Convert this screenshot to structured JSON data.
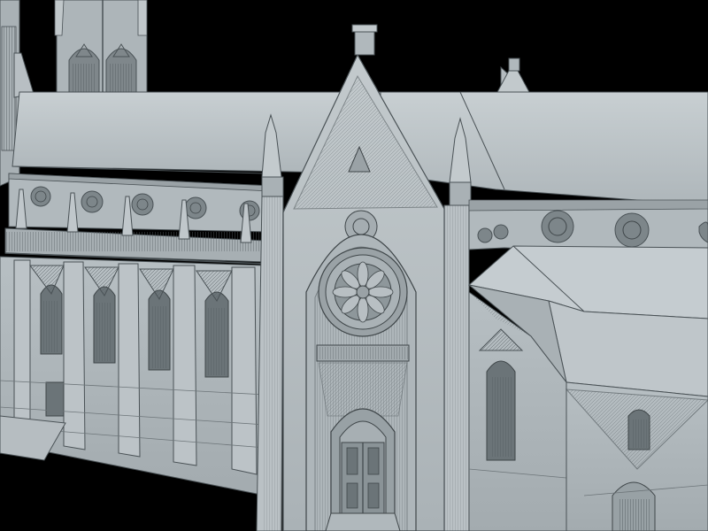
{
  "scene": {
    "subject": "gothic-cathedral-3d-model",
    "render_style": "wireframe-over-shaded",
    "colors": {
      "background": "#000000",
      "surface": "#b4bcc0",
      "surface_light": "#c4cbce",
      "surface_dark": "#8f989c",
      "roof": "#bfc6c9",
      "roof_shadow": "#9aa3a7",
      "line": "#4a5256",
      "line_light": "#6d7579",
      "window": "#5e676b"
    }
  }
}
